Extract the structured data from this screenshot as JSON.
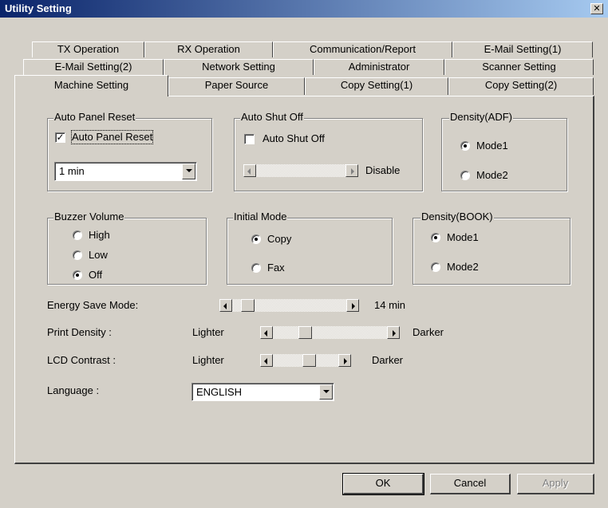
{
  "window": {
    "title": "Utility Setting",
    "close_symbol": "✕"
  },
  "tabs": {
    "row1": [
      "TX Operation",
      "RX Operation",
      "Communication/Report",
      "E-Mail Setting(1)"
    ],
    "row2": [
      "E-Mail Setting(2)",
      "Network Setting",
      "Administrator",
      "Scanner Setting"
    ],
    "row3": [
      "Machine Setting",
      "Paper Source",
      "Copy Setting(1)",
      "Copy Setting(2)"
    ],
    "active": "Machine Setting"
  },
  "auto_panel_reset": {
    "group_label": "Auto Panel Reset",
    "checkbox_label": "Auto Panel Reset",
    "checked": true,
    "check_glyph": "✓",
    "select_value": "1 min"
  },
  "auto_shut_off": {
    "group_label": "Auto Shut Off",
    "checkbox_label": "Auto Shut Off",
    "checked": false,
    "status_text": "Disable"
  },
  "density_adf": {
    "group_label": "Density(ADF)",
    "options": [
      "Mode1",
      "Mode2"
    ],
    "selected": "Mode1"
  },
  "buzzer_volume": {
    "group_label": "Buzzer Volume",
    "options": [
      "High",
      "Low",
      "Off"
    ],
    "selected": "Off"
  },
  "initial_mode": {
    "group_label": "Initial Mode",
    "options": [
      "Copy",
      "Fax"
    ],
    "selected": "Copy"
  },
  "density_book": {
    "group_label": "Density(BOOK)",
    "options": [
      "Mode1",
      "Mode2"
    ],
    "selected": "Mode1"
  },
  "energy_save": {
    "label": "Energy Save Mode:",
    "value_text": "14 min"
  },
  "print_density": {
    "label": "Print Density :",
    "low_label": "Lighter",
    "high_label": "Darker"
  },
  "lcd_contrast": {
    "label": "LCD Contrast :",
    "low_label": "Lighter",
    "high_label": "Darker"
  },
  "language": {
    "label": "Language :",
    "value": "ENGLISH"
  },
  "buttons": {
    "ok": "OK",
    "cancel": "Cancel",
    "apply": "Apply"
  }
}
